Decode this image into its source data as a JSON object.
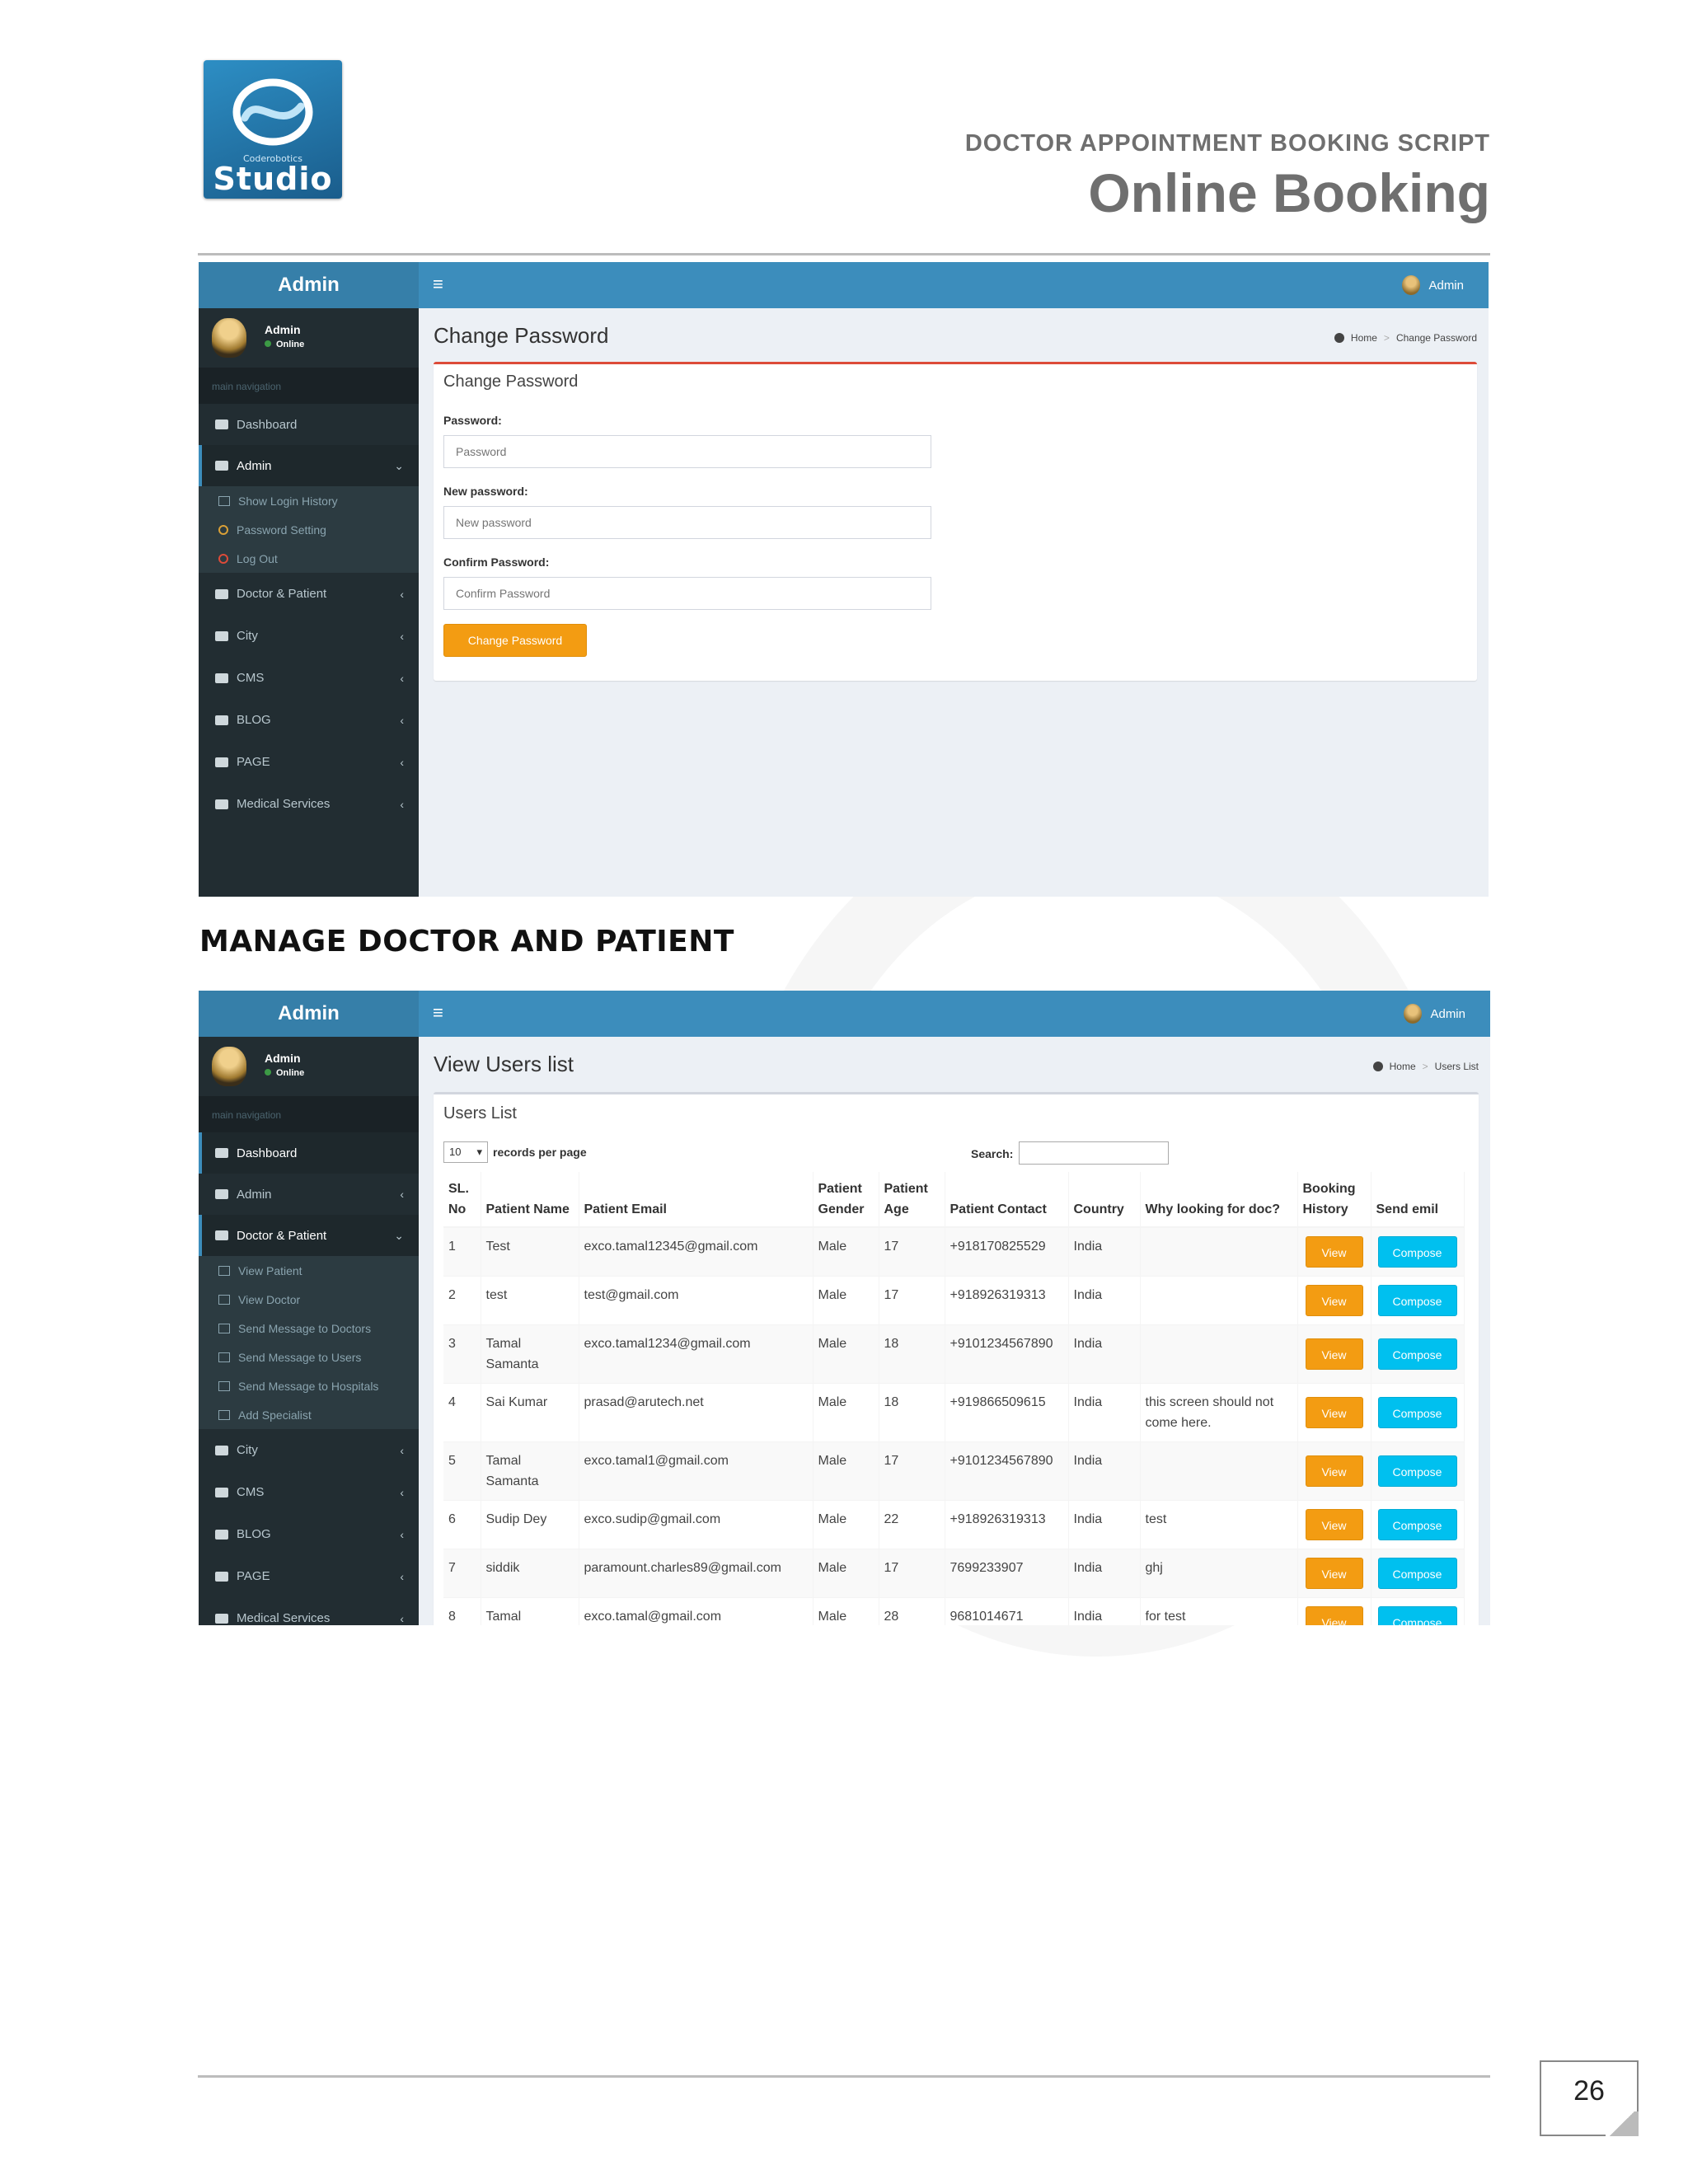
{
  "brand": {
    "small_text": "Coderobotics",
    "big_text": "Studio"
  },
  "doc": {
    "subtitle": "DOCTOR APPOINTMENT BOOKING SCRIPT",
    "title": "Online Booking"
  },
  "section_heading": "MANAGE DOCTOR AND PATIENT",
  "page_number": "26",
  "screen1": {
    "logo": "Admin",
    "top_user": "Admin",
    "user": {
      "name": "Admin",
      "status": "Online"
    },
    "main_nav_label": "main navigation",
    "nav": [
      {
        "label": "Dashboard",
        "icon": "dashboard-icon"
      },
      {
        "label": "Admin",
        "icon": "laptop-icon"
      },
      {
        "label": "Doctor & Patient",
        "icon": "folder-icon"
      },
      {
        "label": "City",
        "icon": "folder-icon"
      },
      {
        "label": "CMS",
        "icon": "folder-icon"
      },
      {
        "label": "BLOG",
        "icon": "folder-icon"
      },
      {
        "label": "PAGE",
        "icon": "folder-icon"
      },
      {
        "label": "Medical Services",
        "icon": "folder-icon"
      }
    ],
    "sub": [
      "Show Login History",
      "Password Setting",
      "Log Out"
    ],
    "page_title": "Change Password",
    "crumb_home": "Home",
    "crumb_current": "Change Password",
    "box_title": "Change Password",
    "fields": [
      {
        "label": "Password:",
        "placeholder": "Password"
      },
      {
        "label": "New password:",
        "placeholder": "New password"
      },
      {
        "label": "Confirm Password:",
        "placeholder": "Confirm Password"
      }
    ],
    "submit": "Change Password"
  },
  "screen2": {
    "logo": "Admin",
    "top_user": "Admin",
    "user": {
      "name": "Admin",
      "status": "Online"
    },
    "main_nav_label": "main navigation",
    "nav": [
      {
        "label": "Dashboard"
      },
      {
        "label": "Admin"
      },
      {
        "label": "Doctor & Patient"
      },
      {
        "label": "City"
      },
      {
        "label": "CMS"
      },
      {
        "label": "BLOG"
      },
      {
        "label": "PAGE"
      },
      {
        "label": "Medical Services"
      }
    ],
    "sub": [
      "View Patient",
      "View Doctor",
      "Send Message to Doctors",
      "Send Message to Users",
      "Send Message to Hospitals",
      "Add Specialist"
    ],
    "page_title": "View Users list",
    "crumb_home": "Home",
    "crumb_current": "Users List",
    "box_title": "Users List",
    "page_size": "10",
    "records_label": "records per page",
    "search_label": "Search:",
    "columns": [
      "SL. No",
      "Patient Name",
      "Patient Email",
      "Patient Gender",
      "Patient Age",
      "Patient Contact",
      "Country",
      "Why looking for doc?",
      "Booking History",
      "Send emil"
    ],
    "rows": [
      {
        "sl": "1",
        "name": "Test",
        "email": "exco.tamal12345@gmail.com",
        "gender": "Male",
        "age": "17",
        "contact": "+918170825529",
        "country": "India",
        "why": ""
      },
      {
        "sl": "2",
        "name": "test",
        "email": "test@gmail.com",
        "gender": "Male",
        "age": "17",
        "contact": "+918926319313",
        "country": "India",
        "why": ""
      },
      {
        "sl": "3",
        "name": "Tamal Samanta",
        "email": "exco.tamal1234@gmail.com",
        "gender": "Male",
        "age": "18",
        "contact": "+9101234567890",
        "country": "India",
        "why": ""
      },
      {
        "sl": "4",
        "name": "Sai Kumar",
        "email": "prasad@arutech.net",
        "gender": "Male",
        "age": "18",
        "contact": "+919866509615",
        "country": "India",
        "why": "this screen should not come here."
      },
      {
        "sl": "5",
        "name": "Tamal Samanta",
        "email": "exco.tamal1@gmail.com",
        "gender": "Male",
        "age": "17",
        "contact": "+9101234567890",
        "country": "India",
        "why": ""
      },
      {
        "sl": "6",
        "name": "Sudip Dey",
        "email": "exco.sudip@gmail.com",
        "gender": "Male",
        "age": "22",
        "contact": "+918926319313",
        "country": "India",
        "why": "test"
      },
      {
        "sl": "7",
        "name": "siddik",
        "email": "paramount.charles89@gmail.com",
        "gender": "Male",
        "age": "17",
        "contact": "7699233907",
        "country": "India",
        "why": "ghj"
      },
      {
        "sl": "8",
        "name": "Tamal",
        "email": "exco.tamal@gmail.com",
        "gender": "Male",
        "age": "28",
        "contact": "9681014671",
        "country": "India",
        "why": "for test"
      }
    ],
    "view_label": "View",
    "compose_label": "Compose"
  }
}
